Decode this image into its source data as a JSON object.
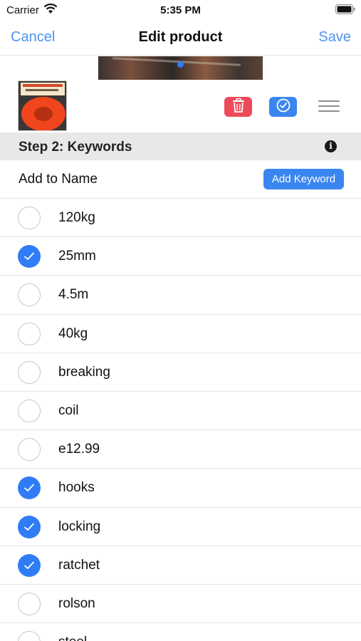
{
  "status_bar": {
    "carrier": "Carrier",
    "time": "5:35 PM",
    "wifi_icon": "wifi-icon",
    "battery_icon": "battery-icon"
  },
  "nav": {
    "cancel_label": "Cancel",
    "title": "Edit product",
    "save_label": "Save"
  },
  "product": {
    "carousel_page_indicator": "page-dot",
    "thumbnail": "product-thumbnail",
    "actions": {
      "delete_icon": "trash-icon",
      "confirm_icon": "check-circle-icon",
      "reorder_icon": "hamburger-icon"
    }
  },
  "section": {
    "title": "Step 2: Keywords",
    "info_icon_glyph": "i"
  },
  "add_row": {
    "label": "Add to Name",
    "button_label": "Add Keyword"
  },
  "colors": {
    "accent": "#2f7cf6",
    "nav_link": "#4e94f0",
    "delete": "#ee4a5a",
    "section_bg": "#e8e8e8"
  },
  "keywords": [
    {
      "label": "120kg",
      "checked": false
    },
    {
      "label": "25mm",
      "checked": true
    },
    {
      "label": "4.5m",
      "checked": false
    },
    {
      "label": "40kg",
      "checked": false
    },
    {
      "label": "breaking",
      "checked": false
    },
    {
      "label": "coil",
      "checked": false
    },
    {
      "label": "e12.99",
      "checked": false
    },
    {
      "label": "hooks",
      "checked": true
    },
    {
      "label": "locking",
      "checked": true
    },
    {
      "label": "ratchet",
      "checked": true
    },
    {
      "label": "rolson",
      "checked": false
    },
    {
      "label": "steel",
      "checked": false
    }
  ]
}
